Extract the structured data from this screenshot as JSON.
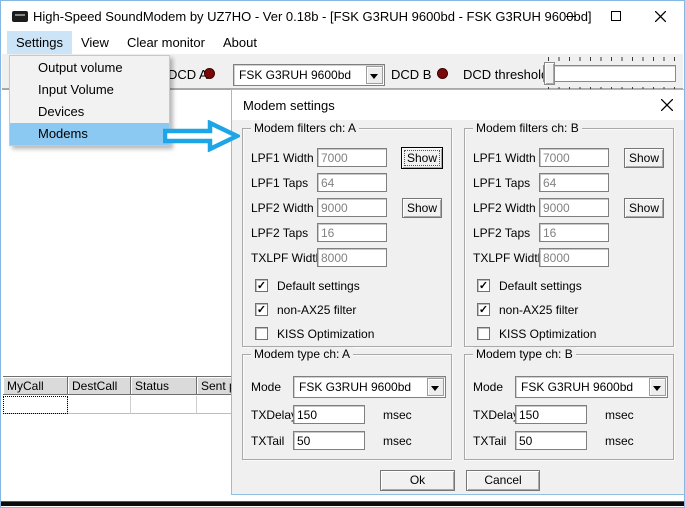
{
  "window": {
    "title": "High-Speed SoundModem by UZ7HO - Ver 0.18b - [FSK G3RUH 9600bd - FSK G3RUH 9600bd]"
  },
  "menubar": {
    "items": [
      "Settings",
      "View",
      "Clear monitor",
      "About"
    ]
  },
  "menu": {
    "items": [
      "Output volume",
      "Input Volume",
      "Devices",
      "Modems"
    ]
  },
  "toolbar": {
    "dcd_a_label": "DCD A",
    "modem_select": "FSK G3RUH 9600bd",
    "dcd_b_label": "DCD B",
    "dcd_threshold_label": "DCD threshold"
  },
  "grid": {
    "columns": [
      "MyCall",
      "DestCall",
      "Status",
      "Sent p"
    ]
  },
  "dialog": {
    "title": "Modem settings",
    "show_label": "Show",
    "filters": [
      {
        "title": "Modem filters ch: A",
        "rows": [
          {
            "label": "LPF1 Width",
            "value": "7000"
          },
          {
            "label": "LPF1 Taps",
            "value": "64"
          },
          {
            "label": "LPF2 Width",
            "value": "9000"
          },
          {
            "label": "LPF2 Taps",
            "value": "16"
          },
          {
            "label": "TXLPF Width",
            "value": "8000"
          }
        ],
        "checkboxes": [
          {
            "label": "Default settings",
            "mark": "✓"
          },
          {
            "label": "non-AX25 filter",
            "mark": "✓"
          },
          {
            "label": "KISS Optimization",
            "mark": ""
          }
        ]
      },
      {
        "title": "Modem filters ch: B",
        "rows": [
          {
            "label": "LPF1 Width",
            "value": "7000"
          },
          {
            "label": "LPF1 Taps",
            "value": "64"
          },
          {
            "label": "LPF2 Width",
            "value": "9000"
          },
          {
            "label": "LPF2 Taps",
            "value": "16"
          },
          {
            "label": "TXLPF Width",
            "value": "8000"
          }
        ],
        "checkboxes": [
          {
            "label": "Default settings",
            "mark": "✓"
          },
          {
            "label": "non-AX25 filter",
            "mark": "✓"
          },
          {
            "label": "KISS Optimization",
            "mark": ""
          }
        ]
      }
    ],
    "types": [
      {
        "title": "Modem type ch: A",
        "mode_label": "Mode",
        "mode_value": "FSK G3RUH 9600bd",
        "txdelay_label": "TXDelay",
        "txdelay_value": "150",
        "txtail_label": "TXTail",
        "txtail_value": "50",
        "unit": "msec"
      },
      {
        "title": "Modem type ch: B",
        "mode_label": "Mode",
        "mode_value": "FSK G3RUH 9600bd",
        "txdelay_label": "TXDelay",
        "txdelay_value": "150",
        "txtail_label": "TXTail",
        "txtail_value": "50",
        "unit": "msec"
      }
    ],
    "ok_label": "Ok",
    "cancel_label": "Cancel"
  },
  "colors": {
    "led": "#7a0a0a",
    "arrow": "#1da5e8",
    "menu_highlight": "#8bc9f3",
    "menubar_highlight": "#cce4f7"
  }
}
